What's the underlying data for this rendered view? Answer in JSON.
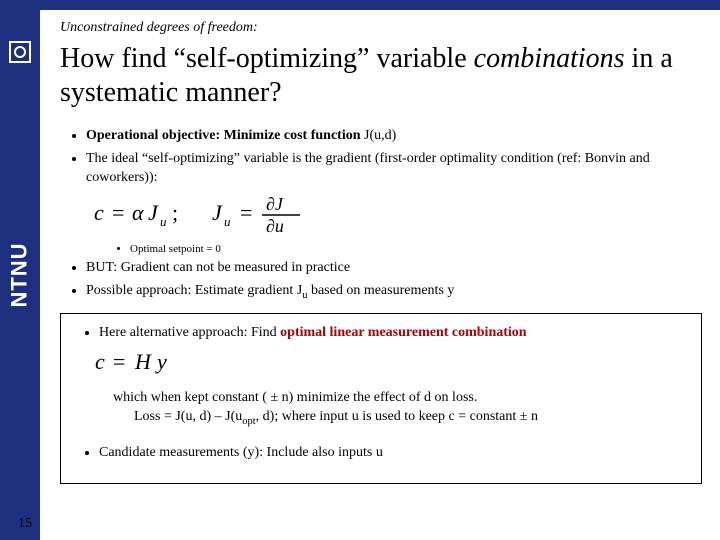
{
  "brand": {
    "name": "NTNU"
  },
  "header": {
    "overline": "Unconstrained degrees of freedom:"
  },
  "title": {
    "part1": "How find “self-optimizing” variable ",
    "combinations": "combinations",
    "part2": " in a systematic manner?"
  },
  "bullets": {
    "b1_prefix": "Operational objective: Minimize cost function",
    "b1_suffix": " J(u,d)",
    "b2": "The ideal “self-optimizing” variable is the gradient (first-order optimality condition (ref: Bonvin and coworkers)):",
    "sub1": "Optimal setpoint = 0",
    "b3": "BUT: Gradient can not be measured in practice",
    "b4_prefix": "Possible approach: Estimate gradient J",
    "b4_sub": "u",
    "b4_suffix": " based on measurements y"
  },
  "box": {
    "line1_prefix": "Here alternative approach: Find ",
    "line1_highlight": "optimal linear measurement combination",
    "tail1": "which when kept constant ( ± n) minimize the effect of d on loss.",
    "tail2_prefix": "Loss = J(u, d) – J(u",
    "tail2_sub": "opt",
    "tail2_suffix": ", d);  where input u is used to keep c = constant ± n",
    "line2": "Candidate measurements (y): Include also inputs u"
  },
  "chart_data": [
    {
      "type": "equation",
      "latex": "c = \\alpha J_u",
      "display": "c = αJ_u"
    },
    {
      "type": "equation",
      "latex": "J_u = \\dfrac{\\partial J}{\\partial u}",
      "display": "J_u = ∂J/∂u"
    },
    {
      "type": "equation",
      "latex": "c = H y",
      "display": "c = Hy"
    }
  ],
  "page": {
    "number": "15"
  }
}
